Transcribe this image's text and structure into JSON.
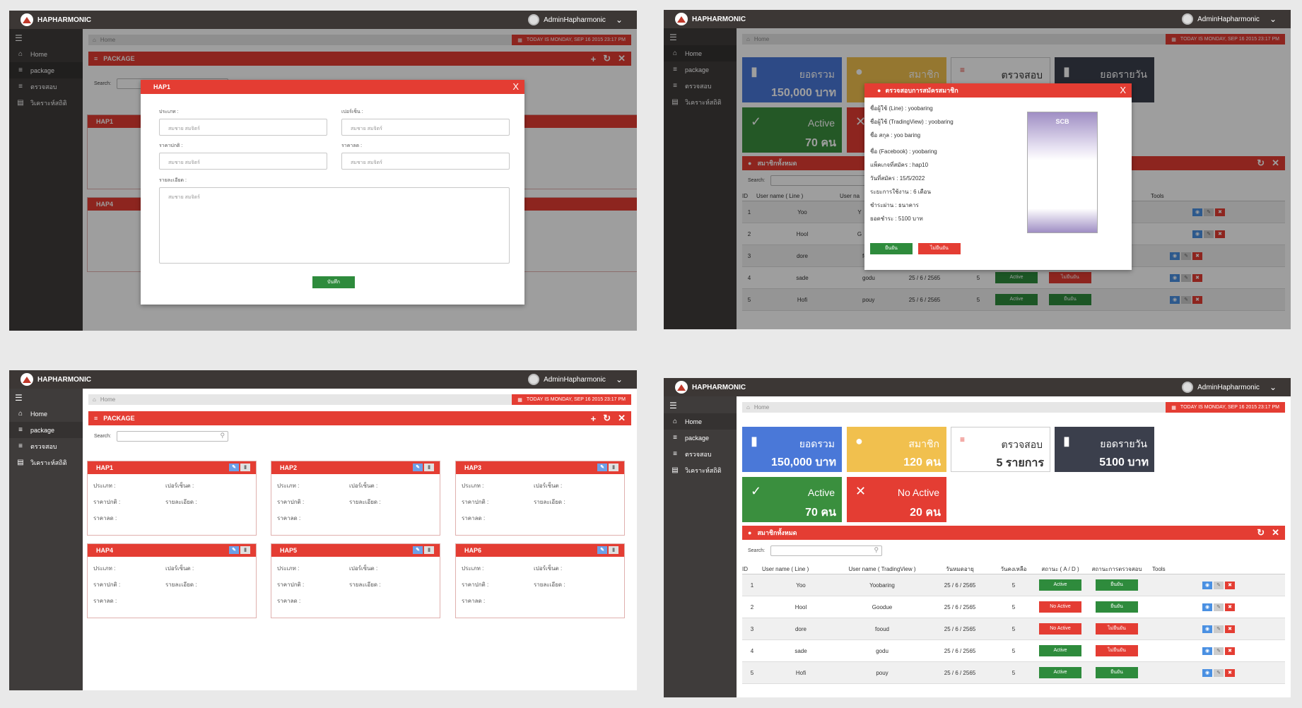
{
  "brand": "HAPHARMONIC",
  "user": "AdminHapharmonic",
  "crumb": "Home",
  "date": "TODAY IS MONDAY, SEP 16 2015 23:17 PM",
  "nav": [
    "Home",
    "package",
    "ตรวจสอบ",
    "วิเคราะห์สถิติ"
  ],
  "pkg": {
    "title": "PACKAGE",
    "search": "Search:",
    "cards": [
      {
        "name": "HAP1"
      },
      {
        "name": "HAP2"
      },
      {
        "name": "HAP3"
      },
      {
        "name": "HAP4"
      },
      {
        "name": "HAP5"
      },
      {
        "name": "HAP6"
      }
    ],
    "labels": {
      "type": "ประเภท :",
      "pct": "เปอร์เซ็นต :",
      "price": "ราคาปกติ :",
      "detail": "รายละเอียด :",
      "sale": "ราคาลด :"
    }
  },
  "modal1": {
    "title": "HAP1",
    "close": "X",
    "f_type": "ประเภท :",
    "f_pct": "เปอร์เซ็น :",
    "f_price": "ราคาปกติ :",
    "f_sale": "ราคาลด :",
    "f_detail": "รายละเอียด :",
    "ph": "สมชาย สมจิตร์",
    "save": "บันทึก"
  },
  "stats": [
    {
      "title": "ยอดรวม",
      "value": "150,000 บาท",
      "color": "#4a78d8"
    },
    {
      "title": "สมาชิก",
      "value": "120 คน",
      "color": "#f1c04e"
    },
    {
      "title": "ตรวจสอบ",
      "value": "5 รายการ",
      "color": "#ffffff"
    },
    {
      "title": "ยอดรายวัน",
      "value": "5100 บาท",
      "color": "#3b3f4c"
    },
    {
      "title": "Active",
      "value": "70 คน",
      "color": "#3a8f3e"
    },
    {
      "title": "No Active",
      "value": "20 คน",
      "color": "#e43d33"
    }
  ],
  "members": {
    "title": "สมาชิกทั้งหมด",
    "search": "Search:",
    "headers": [
      "ID",
      "User name ( Line )",
      "User name ( TradingView )",
      "วันหมดอายุ",
      "วันคงเหลือ",
      "สถานะ ( A / D )",
      "สถานะการตรวจสอบ",
      "Tools"
    ],
    "rows": [
      {
        "id": "1",
        "line": "Yoo",
        "tv": "Yoobaring",
        "exp": "25 / 6 / 2565",
        "left": "5",
        "status": "Active",
        "check": "ยืนยัน"
      },
      {
        "id": "2",
        "line": "Hool",
        "tv": "Goodue",
        "exp": "25 / 6 / 2565",
        "left": "5",
        "status": "No Active",
        "check": "ยืนยัน"
      },
      {
        "id": "3",
        "line": "dore",
        "tv": "fooud",
        "exp": "25 / 6 / 2565",
        "left": "5",
        "status": "No Active",
        "check": "ไม่ยืนยัน"
      },
      {
        "id": "4",
        "line": "sade",
        "tv": "godu",
        "exp": "25 / 6 / 2565",
        "left": "5",
        "status": "Active",
        "check": "ไม่ยืนยัน"
      },
      {
        "id": "5",
        "line": "Hofi",
        "tv": "pouy",
        "exp": "25 / 6 / 2565",
        "left": "5",
        "status": "Active",
        "check": "ยืนยัน"
      }
    ],
    "rows_bg": [
      {
        "tv": "Y"
      },
      {
        "tv": "G"
      },
      {
        "tv": "fooud"
      },
      {
        "tv": "godu"
      },
      {
        "tv": "pouy"
      }
    ]
  },
  "modal2": {
    "title": "ตรวจสอบการสมัครสมาชิก",
    "close": "X",
    "lines": [
      "ชื่อผู้ใช้ (Line) : yoobaring",
      "ชื่อผู้ใช้ (TradingView) : yoobaring",
      "ชื่อ สกุล : yoo baring",
      "ชื่อ (Facebook) : yoobaring",
      "แพ็คเกจที่สมัคร : hap10",
      "วันที่สมัคร : 15/5/2022",
      "ระยะการใช้งาน : 6 เดือน",
      "ชำระผ่าน : ธนาคาร",
      "ยอดชำระ : 5100 บาท"
    ],
    "ok": "ยืนยัน",
    "no": "ไม่ยืนยัน",
    "slip_brand": "SCB"
  }
}
